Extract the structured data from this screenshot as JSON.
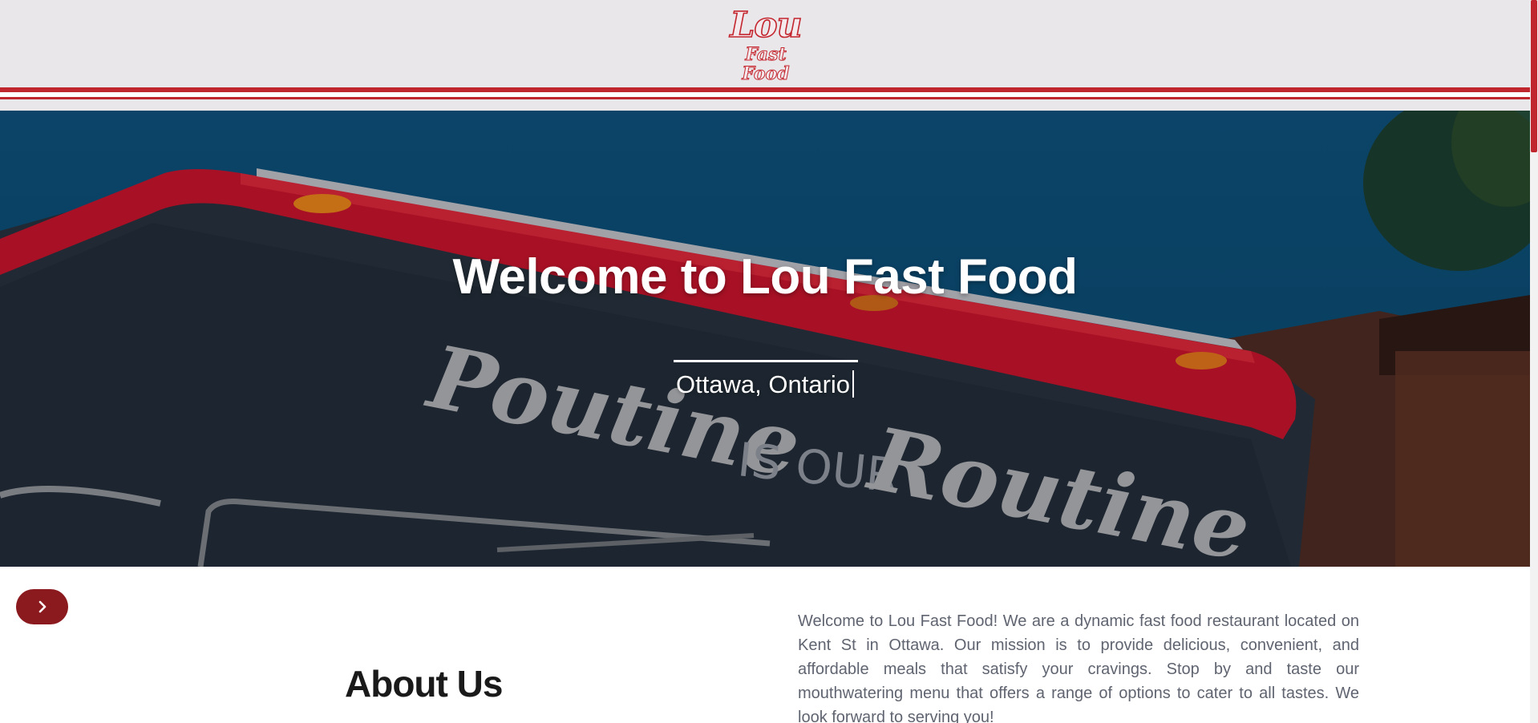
{
  "header": {
    "logo_main": "Lou",
    "logo_sub": "Fast Food"
  },
  "hero": {
    "title": "Welcome to Lou Fast Food",
    "subtitle": "Ottawa, Ontario",
    "truck_lettering": {
      "word1": "Poutine",
      "middle": "IS OUR",
      "word2": "Routine"
    }
  },
  "controls": {
    "next_icon": "chevron-right-icon"
  },
  "about": {
    "heading": "About Us",
    "body": "Welcome to Lou Fast Food! We are a dynamic fast food restaurant located on Kent St in Ottawa. Our mission is to provide delicious, convenient, and affordable meals that satisfy your cravings. Stop by and taste our mouthwatering menu that offers a range of options to cater to all tastes. We look forward to serving you!"
  },
  "colors": {
    "brand_red": "#c0262e",
    "button_red": "#8b1a1e",
    "header_bg": "#eae7ea",
    "sky_blue": "#0d4e77"
  }
}
